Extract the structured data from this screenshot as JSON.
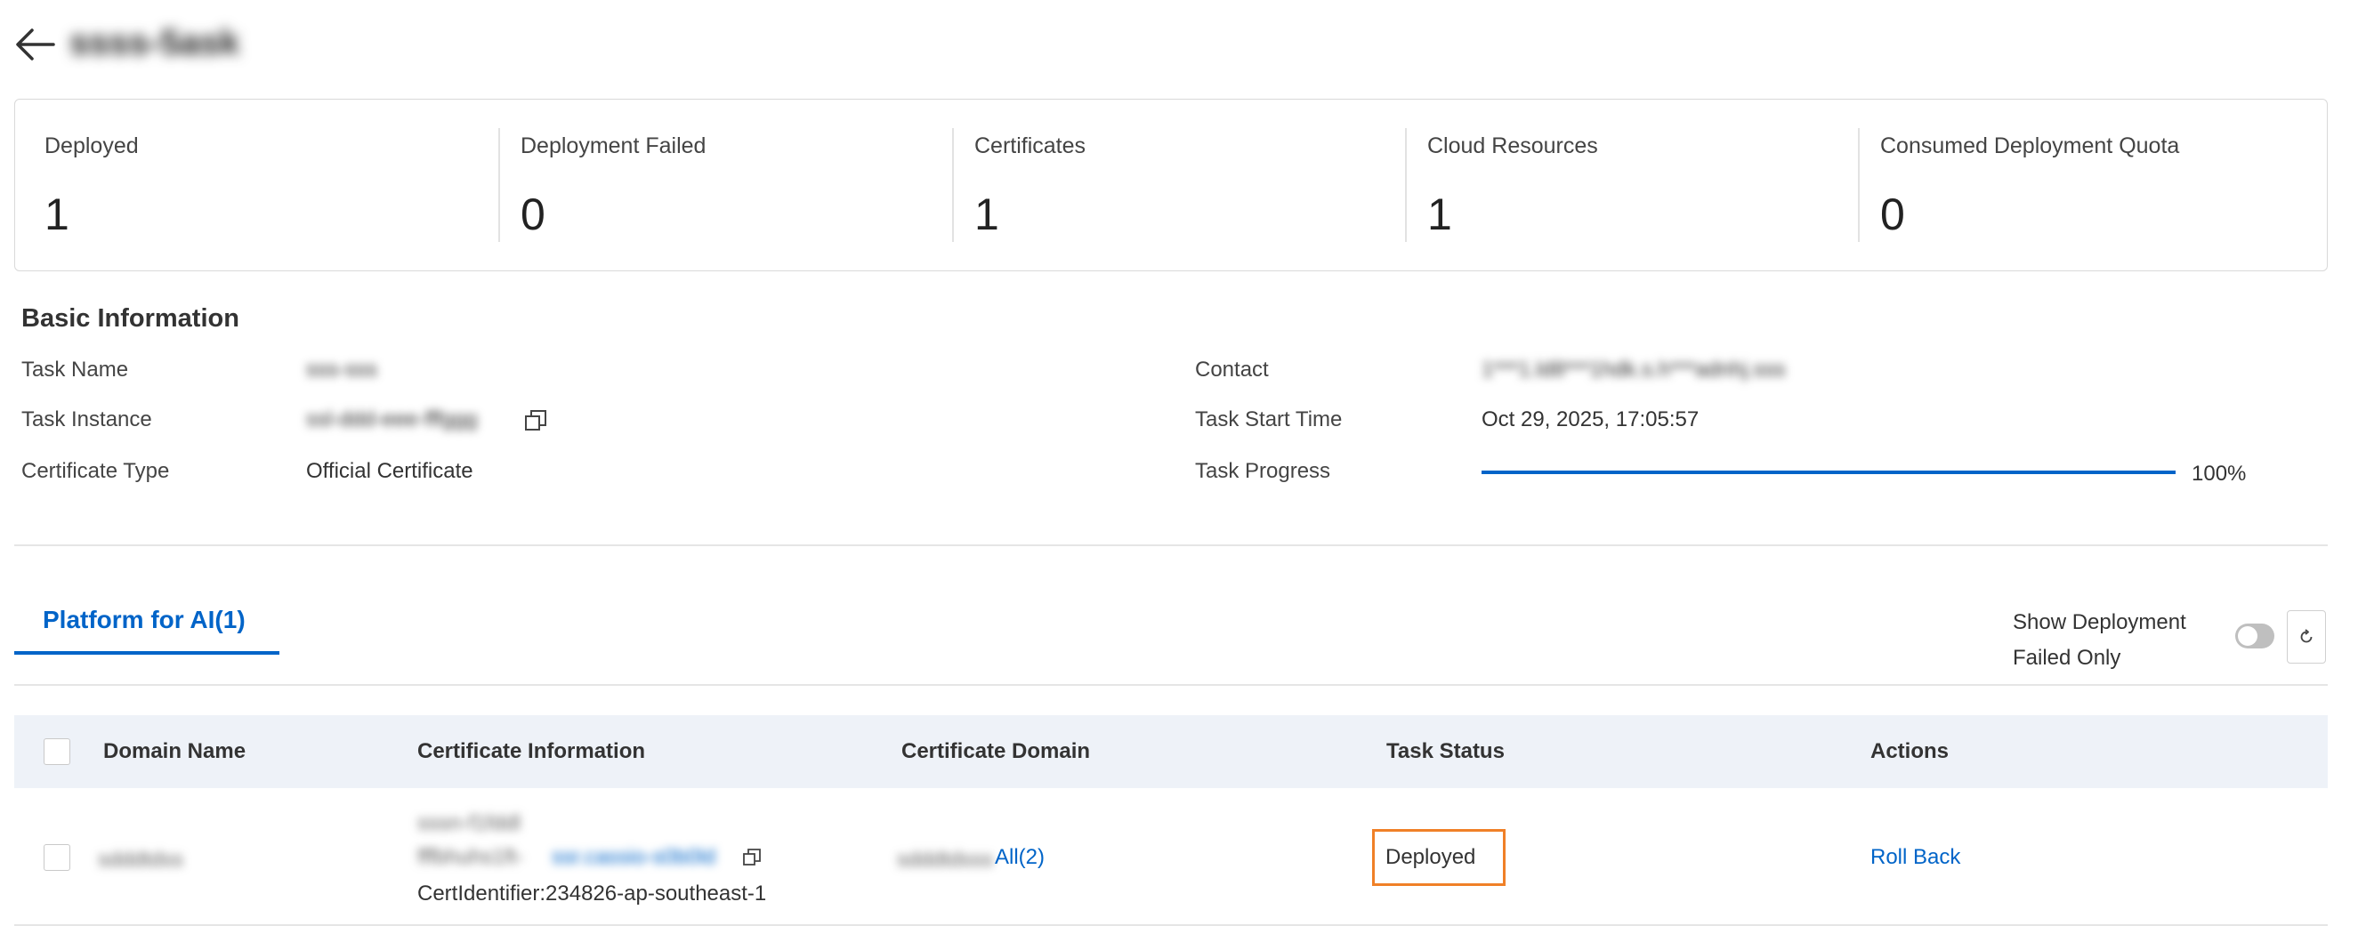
{
  "header": {
    "title": "ssss-5ask"
  },
  "stats": [
    {
      "label": "Deployed",
      "value": "1"
    },
    {
      "label": "Deployment Failed",
      "value": "0"
    },
    {
      "label": "Certificates",
      "value": "1"
    },
    {
      "label": "Cloud Resources",
      "value": "1"
    },
    {
      "label": "Consumed Deployment Quota",
      "value": "0"
    }
  ],
  "basic_info": {
    "title": "Basic Information",
    "task_name_label": "Task Name",
    "task_name_value": "sss-sss",
    "task_instance_label": "Task Instance",
    "task_instance_value": "ssl-ddd-eee-fffggg",
    "certificate_type_label": "Certificate Type",
    "certificate_type_value": "Official Certificate",
    "contact_label": "Contact",
    "contact_value": "1***1.ld8***1hdk.s.h***adnhj.sss",
    "task_start_time_label": "Task Start Time",
    "task_start_time_value": "Oct 29, 2025, 17:05:57",
    "task_progress_label": "Task Progress",
    "task_progress_value": "100%",
    "task_progress_fraction": 1.0
  },
  "tabs": {
    "active": "Platform for AI(1)"
  },
  "filter": {
    "show_failed_label": "Show Deployment Failed Only",
    "show_failed_on": false
  },
  "table": {
    "columns": [
      "Domain Name",
      "Certificate Information",
      "Certificate Domain",
      "Task Status",
      "Actions"
    ],
    "rows": [
      {
        "domain_name": "sdddtdss",
        "cert_name": "sssn-f1fddl",
        "cert_id_prefix": "fffbhuhs1ft-",
        "cert_id_link": "ssr.cassio-s0b0ld",
        "cert_identifier": "CertIdentifier:234826-ap-southeast-1",
        "cert_domain": "sdddtdsss",
        "cert_domain_link": "All(2)",
        "status": "Deployed",
        "action": "Roll Back"
      }
    ]
  },
  "colors": {
    "accent": "#0064c8",
    "highlight": "#f08027"
  }
}
